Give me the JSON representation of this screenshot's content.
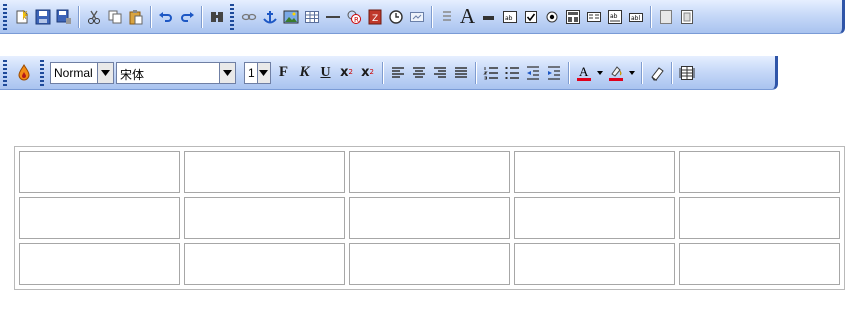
{
  "toolbar_top": {
    "icons": [
      "new-file-icon",
      "save-icon",
      "save-as-icon",
      "cut-icon",
      "copy-icon",
      "paste-icon",
      "undo-icon",
      "redo-icon",
      "find-icon",
      "hyperlink-icon",
      "anchor-icon",
      "insert-image-icon",
      "insert-table-icon",
      "horizontal-rule-icon",
      "special-char-icon",
      "insert-flash-icon",
      "insert-date-icon",
      "insert-media-icon",
      "insert-list-icon",
      "insert-text-icon",
      "insert-line-icon",
      "text-box-icon",
      "checkbox-icon",
      "radio-button-icon",
      "form-icon",
      "form-fields-icon",
      "text-area-icon",
      "input-field-icon",
      "hidden-field-icon",
      "scroll-field-icon"
    ]
  },
  "toolbar_format": {
    "style_value": "Normal",
    "font_value": "宋体",
    "size_value": "1",
    "bold_label": "F",
    "italic_label": "K",
    "underline_label": "U",
    "superscript_label": "x",
    "superscript_mark": "2",
    "subscript_label": "x",
    "subscript_mark": "2",
    "font_color": "#e0001b",
    "highlight_color": "#e0001b"
  },
  "table": {
    "rows": 3,
    "columns": 5
  }
}
